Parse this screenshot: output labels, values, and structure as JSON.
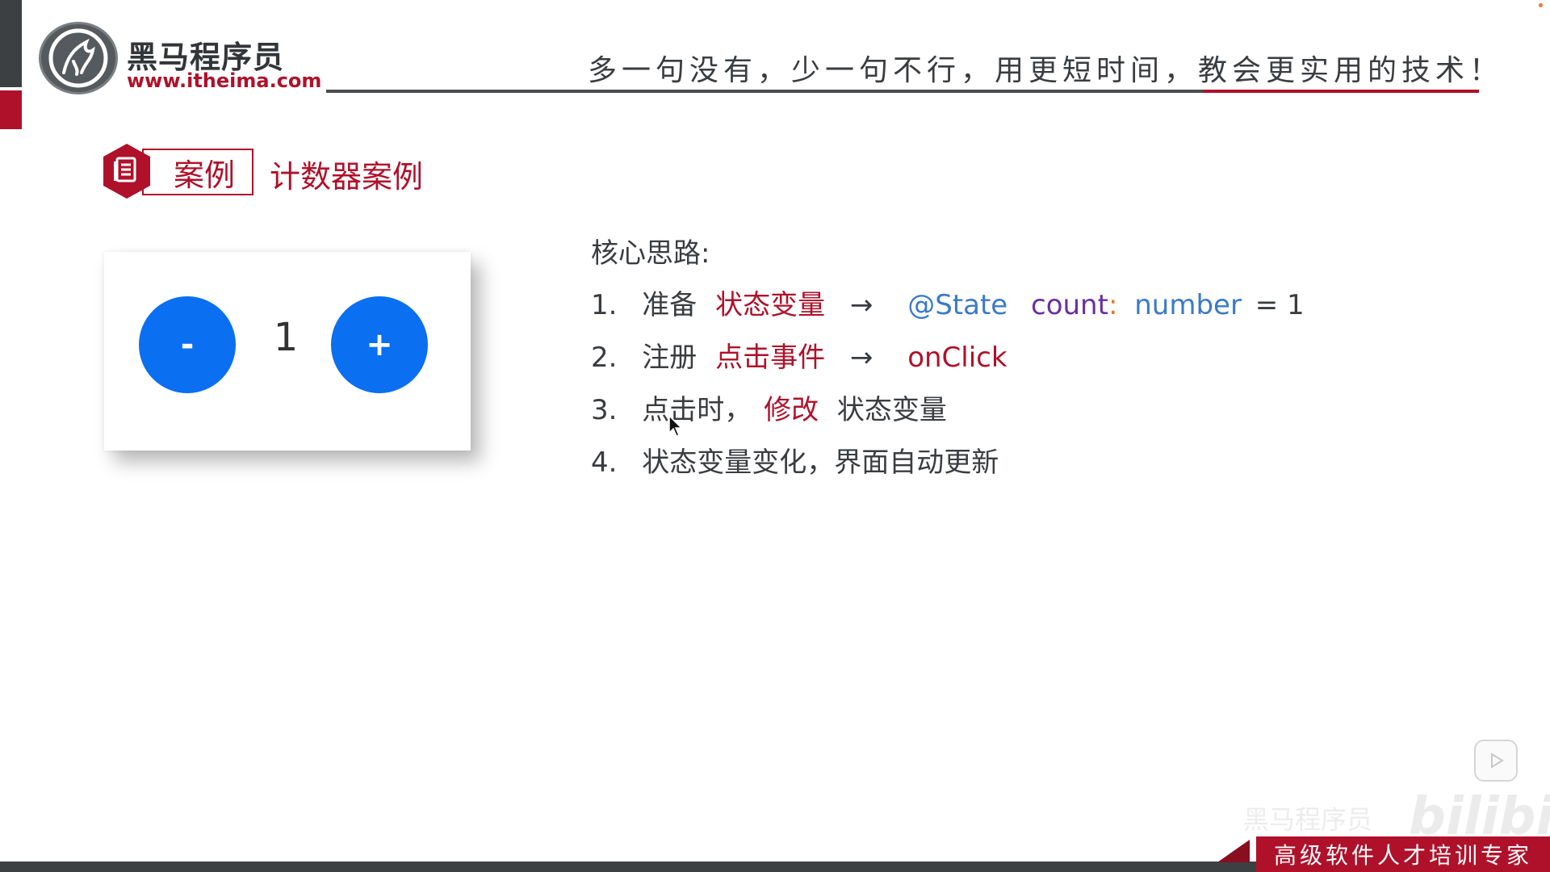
{
  "header": {
    "logo_name": "黑马程序员",
    "logo_url": "www.itheima.com",
    "slogan": "多一句没有，少一句不行，用更短时间，教会更实用的技术！"
  },
  "case": {
    "tag": "案例",
    "title": "计数器案例",
    "icon": "document-icon"
  },
  "counter": {
    "minus_label": "-",
    "plus_label": "+",
    "value": "1",
    "button_color": "#0a6ff0"
  },
  "core": {
    "title": "核心思路:",
    "items": [
      {
        "num": "1.",
        "prefix": "准备",
        "highlight": "状态变量",
        "arrow": "→",
        "code_decorator": "@State",
        "code_var": "count",
        "code_colon": ":",
        "code_type": "number",
        "code_assign": "= 1"
      },
      {
        "num": "2.",
        "prefix": "注册",
        "highlight": "点击事件",
        "arrow": "→",
        "code": "onClick"
      },
      {
        "num": "3.",
        "prefix": "点击时，",
        "highlight": "修改",
        "suffix": "状态变量"
      },
      {
        "num": "4.",
        "text": "状态变量变化，界面自动更新"
      }
    ]
  },
  "footer": {
    "banner": "高级软件人才培训专家",
    "watermark_text": "黑马程序员",
    "watermark_brand": "bilibili"
  },
  "colors": {
    "brand_red": "#b0112a",
    "dark": "#3c4043",
    "code_blue": "#3b7ac8",
    "code_purple": "#6b2fa0",
    "code_orange": "#e07b2a"
  }
}
